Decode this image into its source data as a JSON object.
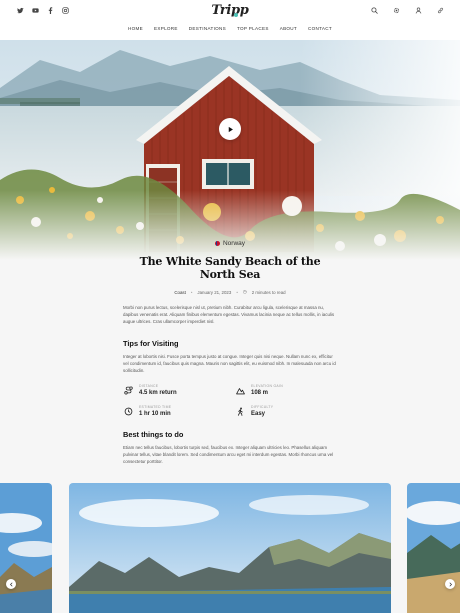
{
  "brand": {
    "logo": "Tripp",
    "accent": "#4dc0b5"
  },
  "social": [
    "twitter-icon",
    "youtube-icon",
    "facebook-icon",
    "instagram-icon"
  ],
  "tools": [
    "search-icon",
    "settings-icon",
    "user-icon",
    "link-icon"
  ],
  "nav": [
    "HOME",
    "EXPLORE",
    "DESTINATIONS",
    "TOP PLACES",
    "ABOUT",
    "CONTACT"
  ],
  "hero": {
    "play_icon": "play-icon"
  },
  "article": {
    "location": "Norway",
    "title": "The White Sandy Beach of the North Sea",
    "category": "Coast",
    "date": "January 21, 2023",
    "read_time": "2 minutes to read",
    "intro": "Morbi non purus lectus, scelerisque nisl ut, pretium nibh. Curabitur arcu ligula, scelerisque at massa nu, dapibus venenatis erat. Aliquam finibus elementum egestas. Vivamus lacinia neque ac tellus mollis, in iaculis augue ultrices. Cras ullamcorper imperdiet nisl.",
    "tips_heading": "Tips for Visiting",
    "tips_text": "Integer at lobortis nisi. Fusce porta tempus justo at congue. Integer quis nisi neque. Nullam nunc ex, efficitur vel condimentum id, faucibus quis magna. Mauris non sagittis elit, eu euismod nibh. In malesuada non arcu id sollicitudin.",
    "stats": [
      {
        "label": "DISTANCE",
        "value": "4.5 km return",
        "icon": "route-icon"
      },
      {
        "label": "ELEVATION GAIN",
        "value": "108 m",
        "icon": "mountain-icon"
      },
      {
        "label": "ESTIMATED TIME",
        "value": "1 hr 10 min",
        "icon": "clock-icon"
      },
      {
        "label": "DIFFICULTY",
        "value": "Easy",
        "icon": "hiker-icon"
      }
    ],
    "best_heading": "Best things to do",
    "best_text": "Etiam nec tellus faucibus, lobortis turpis sed, faucibus ex. Integer aliquam ultricies leo. Phasellus aliquam pulvinar tellus, vitae blandit lorem. Sed condimentum arcu eget mi interdum egestas. Morbi rhoncus urna vel consectetur porttitor."
  },
  "carousel": {
    "prev_icon": "chevron-left-icon",
    "next_icon": "chevron-right-icon"
  }
}
